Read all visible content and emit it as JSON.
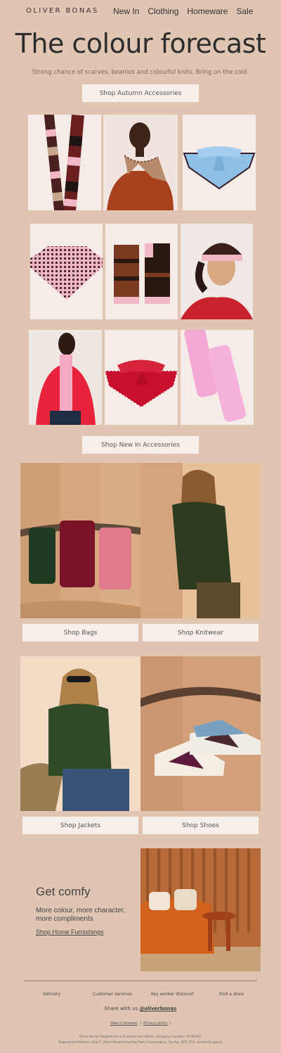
{
  "brand": {
    "logo": "OLIVER BONAS"
  },
  "nav": {
    "items": [
      "New In",
      "Clothing",
      "Homeware",
      "Sale"
    ]
  },
  "hero": {
    "title": "The colour forecast",
    "subtitle": "Strong chance of scarves, beanies and colourful knits. Bring on the cold.",
    "cta": "Shop Autumn Accessories"
  },
  "accessories_cta": "Shop New In Accessories",
  "categories": [
    {
      "label": "Shop Bags"
    },
    {
      "label": "Shop Knitwear"
    },
    {
      "label": "Shop Jackets"
    },
    {
      "label": "Shop Shoes"
    }
  ],
  "comfy": {
    "title": "Get comfy",
    "text": "More colour, more character, more compliments",
    "link": "Shop Home Furnishings"
  },
  "footer": {
    "links": [
      "Delivery",
      "Customer services",
      "Key worker discount",
      "Find a store"
    ],
    "share_prefix": "Share with us ",
    "share_handle": "@oliverbonas",
    "view_browser": "View in browser",
    "privacy": "Privacy policy",
    "separator": "|",
    "legal_1": "Oliver Bonas Registered in England and Wales, company number: 3799350.",
    "legal_2": "Registered Address: Unit F, Davis Road Industrial Park Chessington, Surrey, KT9 1TQ, United Kingdom"
  },
  "colors": {
    "background": "#dfc5b2",
    "button_bg": "#f7efea",
    "tile_bg": "#f6ece7",
    "text": "#333333"
  }
}
